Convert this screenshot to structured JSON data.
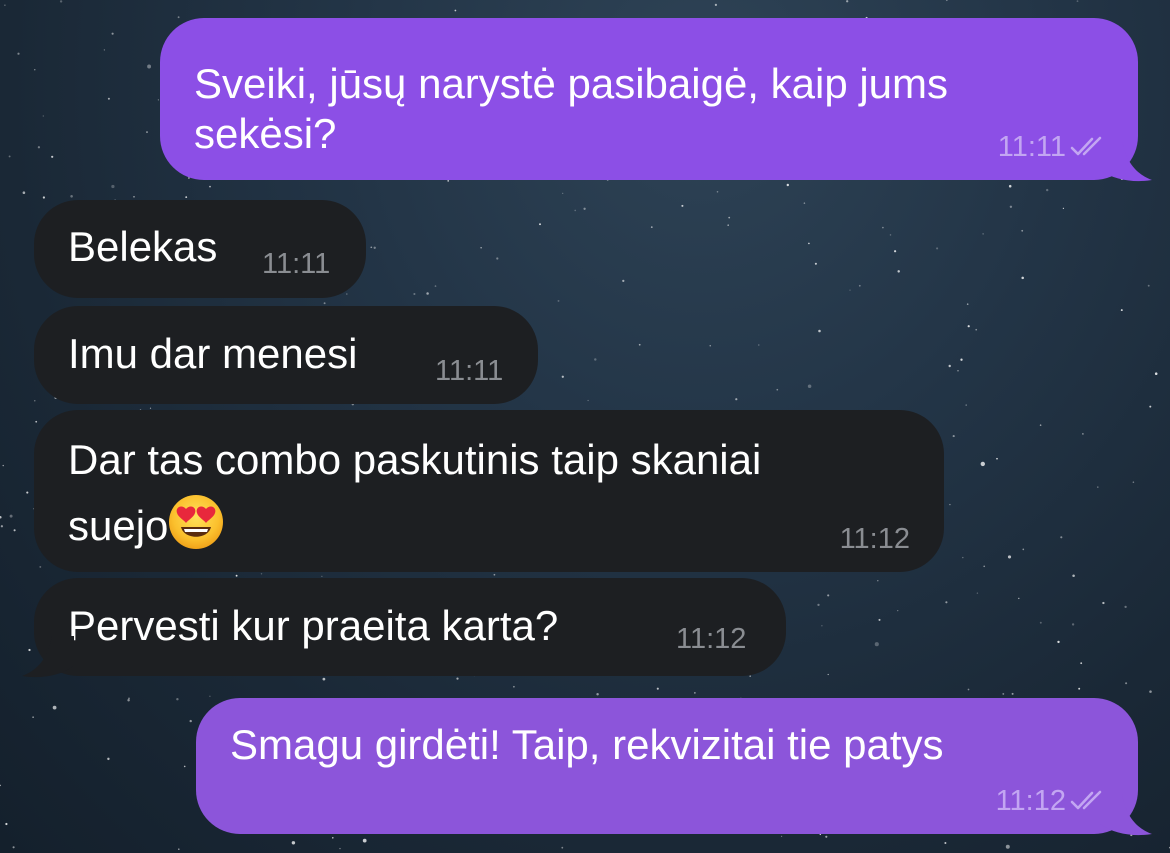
{
  "messages": [
    {
      "direction": "outgoing",
      "lines": [
        "Sveiki, jūsų narystė pasibaigė, kaip jums",
        "sekėsi?"
      ],
      "time": "11:11",
      "status": "read-double-check-icon"
    },
    {
      "direction": "incoming",
      "text": "Belekas",
      "time": "11:11"
    },
    {
      "direction": "incoming",
      "text": "Imu dar menesi",
      "time": "11:11"
    },
    {
      "direction": "incoming",
      "lines": [
        "Dar tas combo paskutinis taip skaniai",
        "suejo"
      ],
      "emoji": "smiling-face-with-heart-eyes-icon",
      "time": "11:12"
    },
    {
      "direction": "incoming",
      "text": "Pervesti kur praeita karta?",
      "time": "11:12"
    },
    {
      "direction": "outgoing",
      "text": "Smagu girdėti! Taip, rekvizitai tie patys",
      "time": "11:12",
      "status": "read-double-check-icon"
    }
  ],
  "colors": {
    "outgoing_bubble": "#8c4fe6",
    "incoming_bubble": "#1d1f22",
    "background": "#1f2f3f",
    "incoming_meta": "#8a8d92",
    "outgoing_meta": "#c3a6f2"
  }
}
